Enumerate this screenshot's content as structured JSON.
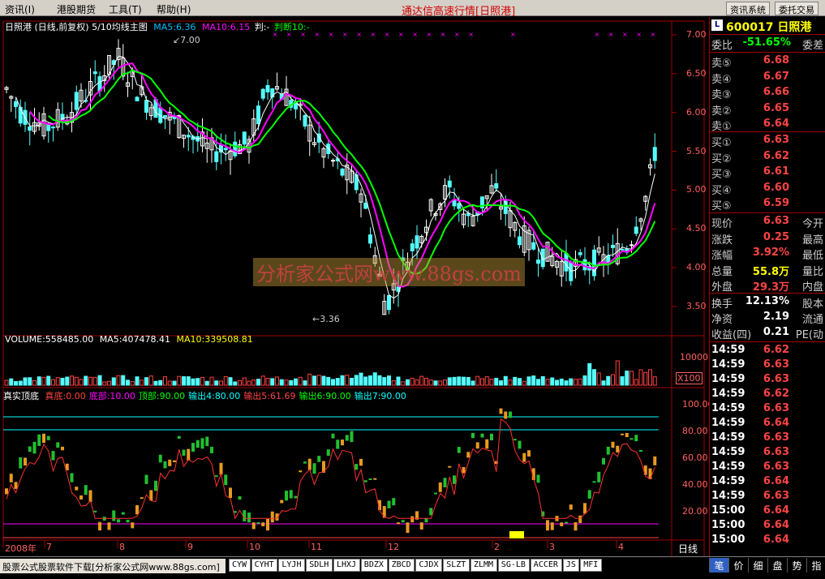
{
  "menu": {
    "items": [
      "资讯(I)",
      "港股期货",
      "工具(T)",
      "帮助(H)"
    ],
    "title": "通达信高速行情[日照港]",
    "btn_info": "资讯系统",
    "btn_trade": "委托交易"
  },
  "chart": {
    "header": "日照港 (日线,前复权) 5/10均线主图",
    "ma5": "MA5:6.36",
    "ma10": "MA10:6.15",
    "judge": "判:-",
    "judge2": "判断10:-",
    "high_mark": "7.00",
    "low_mark": "3.36",
    "price_axis": [
      "7.00",
      "6.50",
      "6.00",
      "5.50",
      "5.00",
      "4.50",
      "4.00",
      "3.50"
    ],
    "watermark": "分析家公式网www.88gs.com",
    "volume_header": "VOLUME:558485.00",
    "vol_ma5": "MA5:407478.41",
    "vol_ma10": "MA10:339508.81",
    "vol_axis": "10000",
    "vol_unit": "X100",
    "ind_name": "真实顶底",
    "ind_items": [
      {
        "label": "真底:0.00",
        "color": "#ff4444"
      },
      {
        "label": "底部:10.00",
        "color": "#ff00ff"
      },
      {
        "label": "顶部:90.00",
        "color": "#00ff00"
      },
      {
        "label": "输出4:80.00",
        "color": "#00ffff"
      },
      {
        "label": "输出5:61.69",
        "color": "#ff4444"
      },
      {
        "label": "输出6:90.00",
        "color": "#00ff00"
      },
      {
        "label": "输出7:90.00",
        "color": "#00ffff"
      }
    ],
    "ind_axis": [
      "100.00",
      "80.00",
      "60.00",
      "40.00",
      "20.00"
    ],
    "date_axis": [
      "2008年",
      "7",
      "8",
      "9",
      "10",
      "11",
      "12",
      "2",
      "3",
      "4"
    ],
    "period": "日线"
  },
  "chart_data": {
    "type": "candlestick",
    "title": "日照港 (日线,前复权) 5/10均线主图",
    "ylim": [
      3.3,
      7.1
    ],
    "high": 7.0,
    "low": 3.36,
    "ma5": 6.36,
    "ma10": 6.15,
    "volume": 558485.0,
    "vol_ma5": 407478.41,
    "vol_ma10": 339508.81
  },
  "quote": {
    "code": "600017",
    "name": "日照港",
    "weibi_label": "委比",
    "weibi": "-51.65%",
    "weicha_label": "委差",
    "sells": [
      {
        "label": "卖⑤",
        "price": "6.68"
      },
      {
        "label": "卖④",
        "price": "6.67"
      },
      {
        "label": "卖③",
        "price": "6.66"
      },
      {
        "label": "卖②",
        "price": "6.65"
      },
      {
        "label": "卖①",
        "price": "6.64"
      }
    ],
    "buys": [
      {
        "label": "买①",
        "price": "6.63"
      },
      {
        "label": "买②",
        "price": "6.62"
      },
      {
        "label": "买③",
        "price": "6.61"
      },
      {
        "label": "买④",
        "price": "6.60"
      },
      {
        "label": "买⑤",
        "price": "6.59"
      }
    ],
    "stats": [
      {
        "label": "现价",
        "value": "6.63",
        "right": "今开",
        "color": "red"
      },
      {
        "label": "涨跌",
        "value": "0.25",
        "right": "最高",
        "color": "red"
      },
      {
        "label": "涨幅",
        "value": "3.92%",
        "right": "最低",
        "color": "red"
      },
      {
        "label": "总量",
        "value": "55.8万",
        "right": "量比",
        "color": "yellow"
      },
      {
        "label": "外盘",
        "value": "29.3万",
        "right": "内盘",
        "color": "red"
      }
    ],
    "stats2": [
      {
        "label": "换手",
        "value": "12.13%",
        "right": "股本",
        "color": "white"
      },
      {
        "label": "净资",
        "value": "2.19",
        "right": "流通",
        "color": "white"
      },
      {
        "label": "收益(四)",
        "value": "0.21",
        "right": "PE(动",
        "color": "white"
      }
    ],
    "ticks": [
      {
        "time": "14:59",
        "price": "6.62"
      },
      {
        "time": "14:59",
        "price": "6.63"
      },
      {
        "time": "14:59",
        "price": "6.63"
      },
      {
        "time": "14:59",
        "price": "6.62"
      },
      {
        "time": "14:59",
        "price": "6.63"
      },
      {
        "time": "14:59",
        "price": "6.64"
      },
      {
        "time": "14:59",
        "price": "6.63"
      },
      {
        "time": "14:59",
        "price": "6.63"
      },
      {
        "time": "14:59",
        "price": "6.63"
      },
      {
        "time": "14:59",
        "price": "6.64"
      },
      {
        "time": "14:59",
        "price": "6.63"
      },
      {
        "time": "15:00",
        "price": "6.64"
      },
      {
        "time": "15:00",
        "price": "6.64"
      },
      {
        "time": "15:00",
        "price": "6.64"
      }
    ]
  },
  "bottom": {
    "ad": "股票公式股票软件下载[分析家公式网www.88gs.com]",
    "tabs": [
      "CYW",
      "CYHT",
      "LYJH",
      "SDLH",
      "LHXJ",
      "BDZX",
      "ZBCD",
      "CJDX",
      "SLZT",
      "ZLMM",
      "SG-LB",
      "ACCER",
      "JS",
      "MFI"
    ],
    "rtabs": [
      "笔",
      "价",
      "细",
      "盘",
      "势",
      "指"
    ]
  }
}
